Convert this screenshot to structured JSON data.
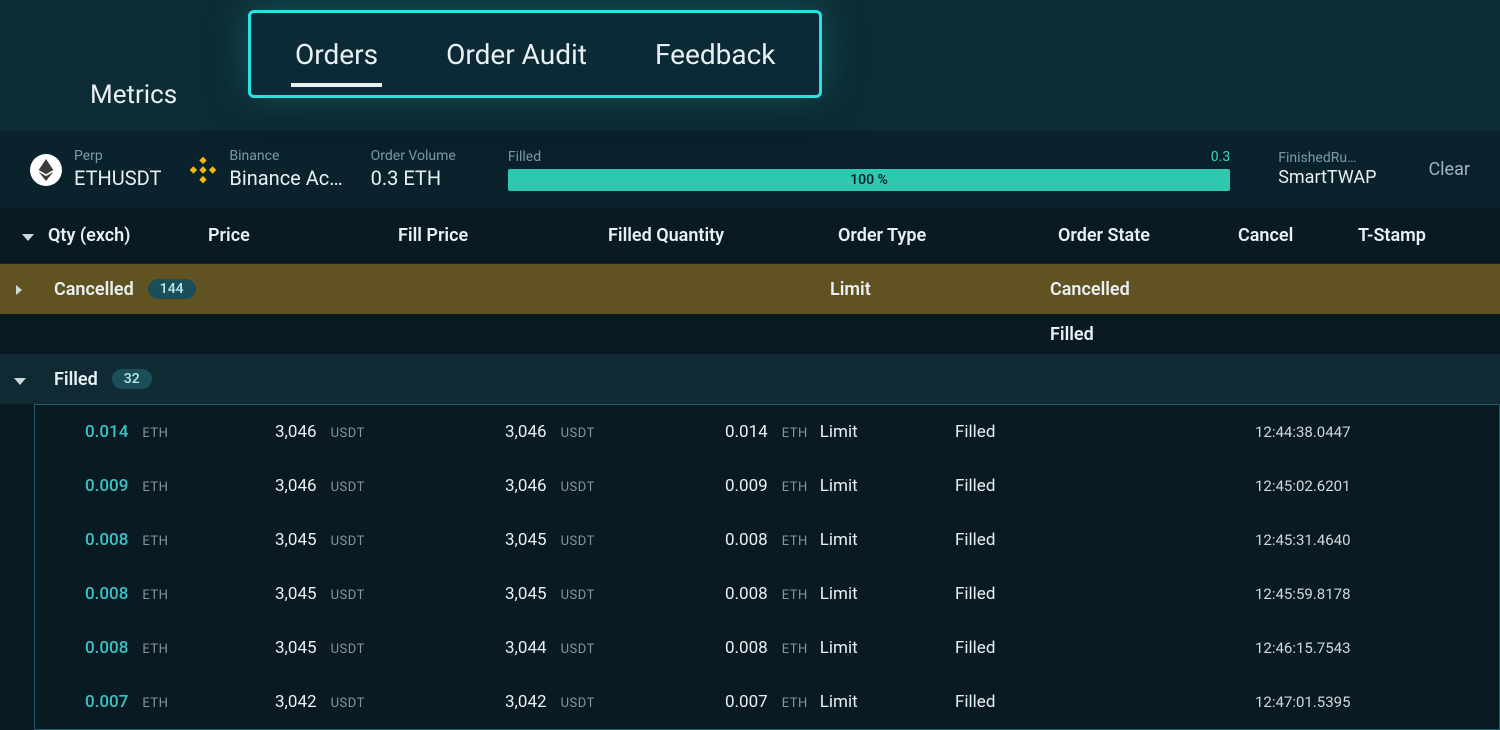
{
  "nav": {
    "metrics": "Metrics",
    "tabs": [
      {
        "label": "Orders",
        "active": true
      },
      {
        "label": "Order Audit",
        "active": false
      },
      {
        "label": "Feedback",
        "active": false
      }
    ]
  },
  "summary": {
    "pair_type": "Perp",
    "pair_symbol": "ETHUSDT",
    "exchange_name": "Binance",
    "exchange_account": "Binance Ac…",
    "order_volume_label": "Order Volume",
    "order_volume_value": "0.3 ETH",
    "filled_label": "Filled",
    "filled_amount": "0.3",
    "filled_percent": "100 %",
    "strategy_label": "FinishedRu…",
    "strategy_value": "SmartTWAP",
    "clear": "Clear"
  },
  "columns": {
    "qty": "Qty (exch)",
    "price": "Price",
    "fill_price": "Fill Price",
    "filled_qty": "Filled Quantity",
    "order_type": "Order Type",
    "order_state": "Order State",
    "cancel": "Cancel",
    "tstamp": "T-Stamp"
  },
  "groups": {
    "cancelled": {
      "label": "Cancelled",
      "count": "144",
      "order_type": "Limit",
      "order_state": "Cancelled"
    },
    "filled": {
      "label": "Filled",
      "count": "32",
      "order_state_header": "Filled"
    }
  },
  "orders": [
    {
      "qty": "0.014",
      "qty_unit": "ETH",
      "price": "3,046",
      "price_unit": "USDT",
      "fill_price": "3,046",
      "fill_unit": "USDT",
      "fqty": "0.014",
      "fqty_unit": "ETH",
      "type": "Limit",
      "state": "Filled",
      "ts": "12:44:38.0447"
    },
    {
      "qty": "0.009",
      "qty_unit": "ETH",
      "price": "3,046",
      "price_unit": "USDT",
      "fill_price": "3,046",
      "fill_unit": "USDT",
      "fqty": "0.009",
      "fqty_unit": "ETH",
      "type": "Limit",
      "state": "Filled",
      "ts": "12:45:02.6201"
    },
    {
      "qty": "0.008",
      "qty_unit": "ETH",
      "price": "3,045",
      "price_unit": "USDT",
      "fill_price": "3,045",
      "fill_unit": "USDT",
      "fqty": "0.008",
      "fqty_unit": "ETH",
      "type": "Limit",
      "state": "Filled",
      "ts": "12:45:31.4640"
    },
    {
      "qty": "0.008",
      "qty_unit": "ETH",
      "price": "3,045",
      "price_unit": "USDT",
      "fill_price": "3,045",
      "fill_unit": "USDT",
      "fqty": "0.008",
      "fqty_unit": "ETH",
      "type": "Limit",
      "state": "Filled",
      "ts": "12:45:59.8178"
    },
    {
      "qty": "0.008",
      "qty_unit": "ETH",
      "price": "3,045",
      "price_unit": "USDT",
      "fill_price": "3,044",
      "fill_unit": "USDT",
      "fqty": "0.008",
      "fqty_unit": "ETH",
      "type": "Limit",
      "state": "Filled",
      "ts": "12:46:15.7543"
    },
    {
      "qty": "0.007",
      "qty_unit": "ETH",
      "price": "3,042",
      "price_unit": "USDT",
      "fill_price": "3,042",
      "fill_unit": "USDT",
      "fqty": "0.007",
      "fqty_unit": "ETH",
      "type": "Limit",
      "state": "Filled",
      "ts": "12:47:01.5395"
    }
  ]
}
